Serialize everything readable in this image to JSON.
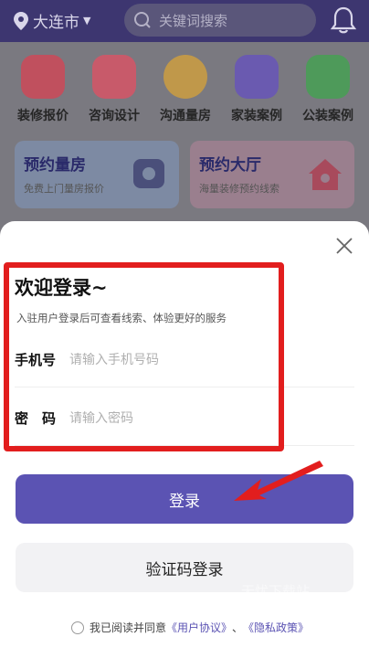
{
  "header": {
    "city": "大连市",
    "search_placeholder": "关键词搜索"
  },
  "grid": [
    {
      "label": "装修报价",
      "icon": "calculator-icon",
      "color": "#c0505e"
    },
    {
      "label": "咨询设计",
      "icon": "chat-icon",
      "color": "#c85a6a"
    },
    {
      "label": "沟通量房",
      "icon": "tape-measure-icon",
      "color": "#c0984a"
    },
    {
      "label": "家装案例",
      "icon": "washer-icon",
      "color": "#6a5ab0"
    },
    {
      "label": "公装案例",
      "icon": "shop-icon",
      "color": "#4e9a5a"
    }
  ],
  "cards": [
    {
      "title": "预约量房",
      "subtitle": "免费上门量房报价"
    },
    {
      "title": "预约大厅",
      "subtitle": "海量装修预约线索"
    }
  ],
  "login": {
    "title": "欢迎登录~",
    "subtitle": "入驻用户登录后可查看线索、体验更好的服务",
    "phone_label": "手机号",
    "phone_placeholder": "请输入手机号码",
    "password_label": "密　码",
    "password_placeholder": "请输入密码",
    "login_button": "登录",
    "code_login_button": "验证码登录",
    "agree_prefix": "我已阅读并同意",
    "user_agreement": "《用户协议》",
    "separator": "、",
    "privacy_policy": "《隐私政策》"
  },
  "colors": {
    "accent": "#5b53b3",
    "highlight": "#e21e1e"
  }
}
